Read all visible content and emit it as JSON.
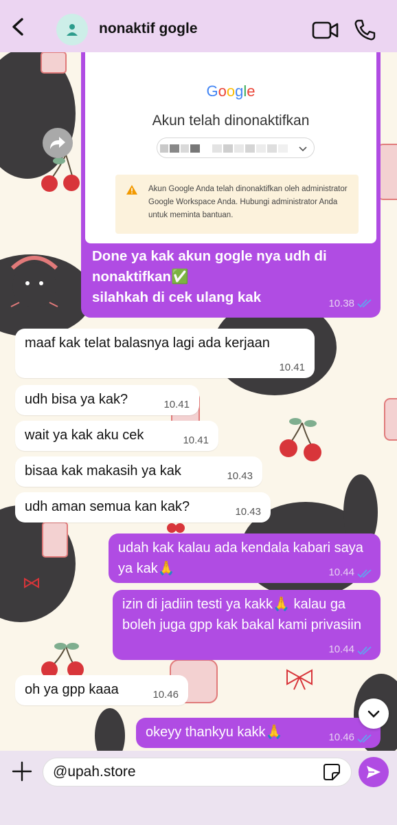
{
  "header": {
    "back_icon": "back-arrow-icon",
    "contact_name": "nonaktif gogle",
    "video_icon": "video-call-icon",
    "call_icon": "phone-icon"
  },
  "image_message": {
    "screenshot": {
      "logo": "Google",
      "title": "Akun telah dinonaktifkan",
      "warning": "Akun Google Anda telah dinonaktifkan oleh administrator Google Workspace Anda. Hubungi administrator Anda untuk meminta bantuan."
    },
    "caption_line1": "Done ya kak akun gogle nya udh di",
    "caption_line2": "nonaktifkan✅",
    "caption_line3": "silahkah di cek ulang kak",
    "time": "10.38"
  },
  "messages": [
    {
      "text": "maaf kak telat balasnya lagi ada kerjaan",
      "time": "10.41",
      "dir": "in"
    },
    {
      "text": "udh bisa ya kak?",
      "time": "10.41",
      "dir": "in"
    },
    {
      "text": "wait ya kak aku cek",
      "time": "10.41",
      "dir": "in"
    },
    {
      "text": "bisaa kak makasih ya kak",
      "time": "10.43",
      "dir": "in"
    },
    {
      "text": "udh aman semua kan kak?",
      "time": "10.43",
      "dir": "in"
    },
    {
      "text": "udah kak kalau ada kendala kabari saya ya kak🙏",
      "time": "10.44",
      "dir": "out"
    },
    {
      "text": "izin di jadiin testi ya kakk🙏 kalau ga boleh juga gpp kak bakal kami privasiin",
      "time": "10.44",
      "dir": "out"
    },
    {
      "text": "oh ya gpp kaaa",
      "time": "10.46",
      "dir": "in"
    },
    {
      "text": "okeyy thankyu kakk🙏",
      "time": "10.46",
      "dir": "out"
    }
  ],
  "composer": {
    "value": "@upah.store",
    "plus_icon": "plus-icon",
    "sticker_icon": "sticker-icon",
    "send_icon": "send-icon"
  },
  "colors": {
    "outgoing_bubble": "#b04ce3",
    "incoming_bubble": "#ffffff",
    "header": "#ecd5f2",
    "read_ticks": "#5fa4f0"
  }
}
